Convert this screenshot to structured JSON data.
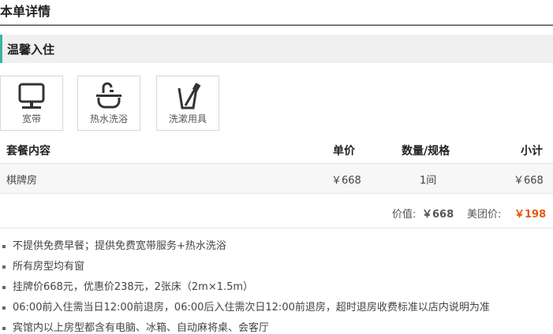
{
  "page": {
    "title": "本单详情"
  },
  "section": {
    "title": "温馨入住"
  },
  "amenities": [
    {
      "label": "宽带",
      "icon": "broadband-icon"
    },
    {
      "label": "热水洗浴",
      "icon": "hot-water-bath-icon"
    },
    {
      "label": "洗漱用具",
      "icon": "toiletries-icon"
    }
  ],
  "table": {
    "headers": {
      "content": "套餐内容",
      "unit_price": "单价",
      "quantity": "数量/规格",
      "subtotal": "小计"
    },
    "rows": [
      {
        "content": "棋牌房",
        "unit_price": "￥668",
        "quantity": "1间",
        "subtotal": "￥668"
      }
    ]
  },
  "totals": {
    "price_label": "价值:",
    "price_value": "￥668",
    "group_label": "美团价:",
    "group_value": "￥198"
  },
  "notes": [
    "不提供免费早餐；提供免费宽带服务+热水洗浴",
    "所有房型均有窗",
    "挂牌价668元，优惠价238元，2张床（2m×1.5m）",
    "06:00前入住需当日12:00前退房，06:00后入住需次日12:00前退房，超时退房收费标准以店内说明为准",
    "宾馆内以上房型都含有电脑、冰箱、自动麻将桌、会客厅"
  ],
  "colors": {
    "accent": "#3cb3a3",
    "price": "#e25a0c"
  }
}
